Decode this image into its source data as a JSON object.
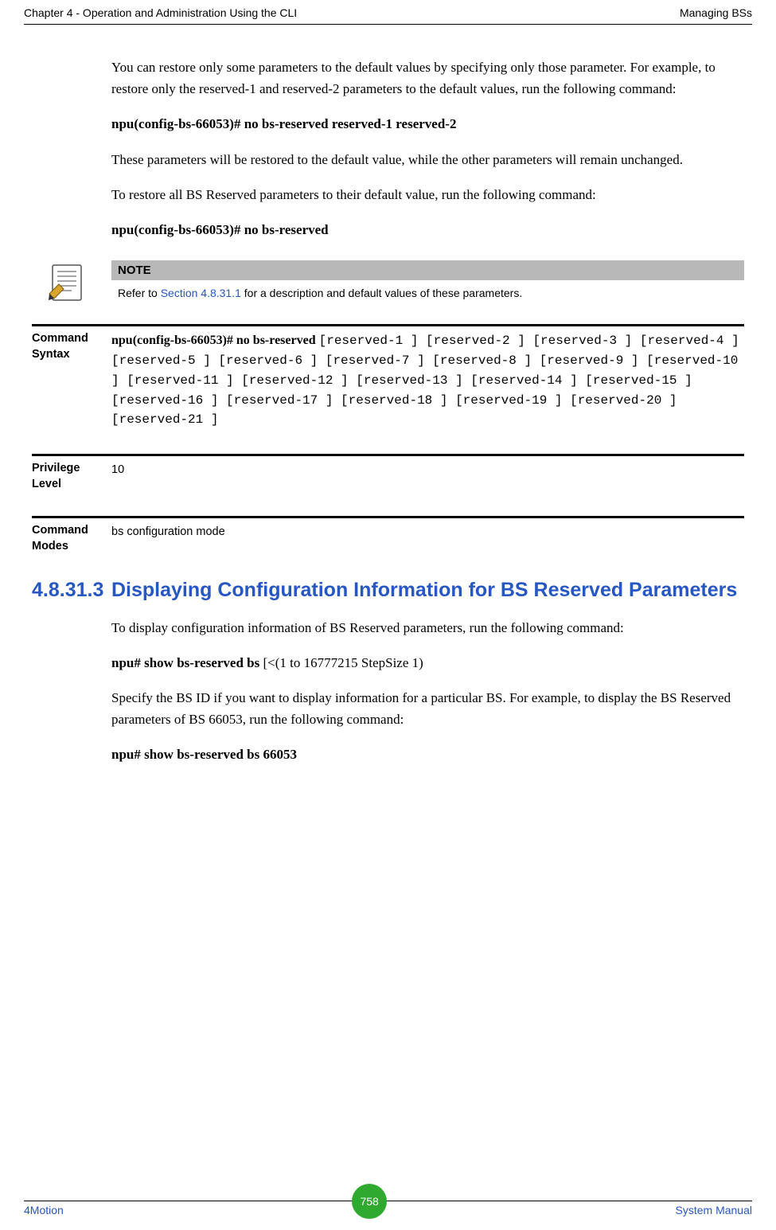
{
  "header": {
    "left": "Chapter 4 - Operation and Administration Using the CLI",
    "right": "Managing BSs"
  },
  "body": {
    "p1": "You can restore only some parameters to the default values by specifying only those parameter. For example, to restore only the reserved-1 and reserved-2 parameters to the default values, run the following command:",
    "cmd1": "npu(config-bs-66053)# no bs-reserved reserved-1 reserved-2",
    "p2": "These parameters will be restored to the default value, while the other parameters will remain unchanged.",
    "p3": "To restore all BS Reserved parameters to their default value, run the following command:",
    "cmd2": "npu(config-bs-66053)# no bs-reserved"
  },
  "note": {
    "title": "NOTE",
    "prefix": "Refer to ",
    "link": "Section 4.8.31.1",
    "suffix": " for a description and default values of these parameters."
  },
  "defs": {
    "syntax_label": "Command Syntax",
    "syntax_bold": "npu(config-bs-66053)# no bs-reserved ",
    "syntax_rest": "[reserved-1 ] [reserved-2 ] [reserved-3 ] [reserved-4 ] [reserved-5 ] [reserved-6 ] [reserved-7 ] [reserved-8 ] [reserved-9 ] [reserved-10 ] [reserved-11 ] [reserved-12 ] [reserved-13 ] [reserved-14 ] [reserved-15 ] [reserved-16 ] [reserved-17 ] [reserved-18 ] [reserved-19 ] [reserved-20 ] [reserved-21 ]",
    "priv_label": "Privilege Level",
    "priv_value": "10",
    "modes_label": "Command Modes",
    "modes_value": "bs configuration mode"
  },
  "section": {
    "number": "4.8.31.3",
    "title": "Displaying Configuration Information for BS Reserved Parameters"
  },
  "body2": {
    "p1": "To display configuration information of BS Reserved parameters, run the following command:",
    "cmd1_bold": "npu# show bs-reserved bs",
    "cmd1_rest": " [<(1 to 16777215 StepSize 1)",
    "p2": "Specify the BS ID if you want to display information for a particular BS. For example, to display the BS Reserved parameters of BS 66053, run the following command:",
    "cmd2": "npu# show bs-reserved bs 66053"
  },
  "footer": {
    "left": "4Motion",
    "page": "758",
    "right": "System Manual"
  }
}
